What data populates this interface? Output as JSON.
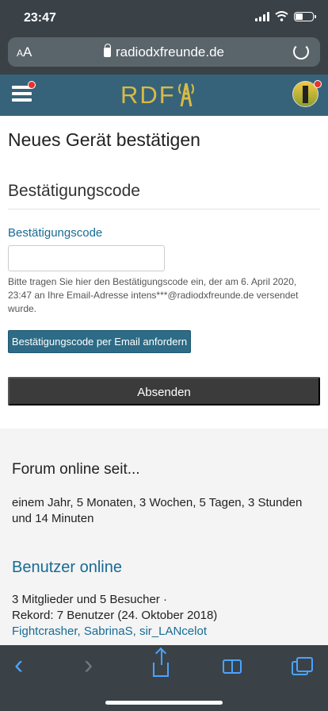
{
  "status": {
    "time": "23:47"
  },
  "browser": {
    "text_size_label": "AA",
    "url": "radiodxfreunde.de"
  },
  "site": {
    "logo_text": "RDF"
  },
  "page": {
    "title": "Neues Gerät bestätigen",
    "section_title": "Bestätigungscode",
    "field_label": "Bestätigungscode",
    "field_value": "",
    "help_text": "Bitte tragen Sie hier den Bestätigungscode ein, der am 6. April 2020, 23:47 an Ihre Email-Adresse intens***@radiodxfreunde.de versendet wurde.",
    "request_button": "Bestätigungscode per Email anfordern",
    "submit_button": "Absenden"
  },
  "forum": {
    "title": "Forum online seit...",
    "duration": "einem Jahr, 5 Monaten, 3 Wochen, 5 Tagen, 3 Stunden und 14 Minuten"
  },
  "users_online": {
    "title": "Benutzer online",
    "summary": "3 Mitglieder und 5 Besucher ·",
    "record": "Rekord: 7 Benutzer (24. Oktober 2018)",
    "names": [
      "Fightcrasher",
      "SabrinaS",
      "sir_LANcelot"
    ]
  },
  "colors": {
    "chrome": "#3a4248",
    "site_header": "#36637a",
    "accent": "#176b95",
    "button": "#2d6b86",
    "submit": "#3b3b3b",
    "logo": "#d9ba44"
  },
  "icons": [
    "signal-icon",
    "wifi-icon",
    "battery-icon",
    "lock-icon",
    "reload-icon",
    "hamburger-icon",
    "radio-tower-icon",
    "avatar",
    "back-icon",
    "forward-icon",
    "share-icon",
    "bookmarks-icon",
    "tabs-icon"
  ]
}
